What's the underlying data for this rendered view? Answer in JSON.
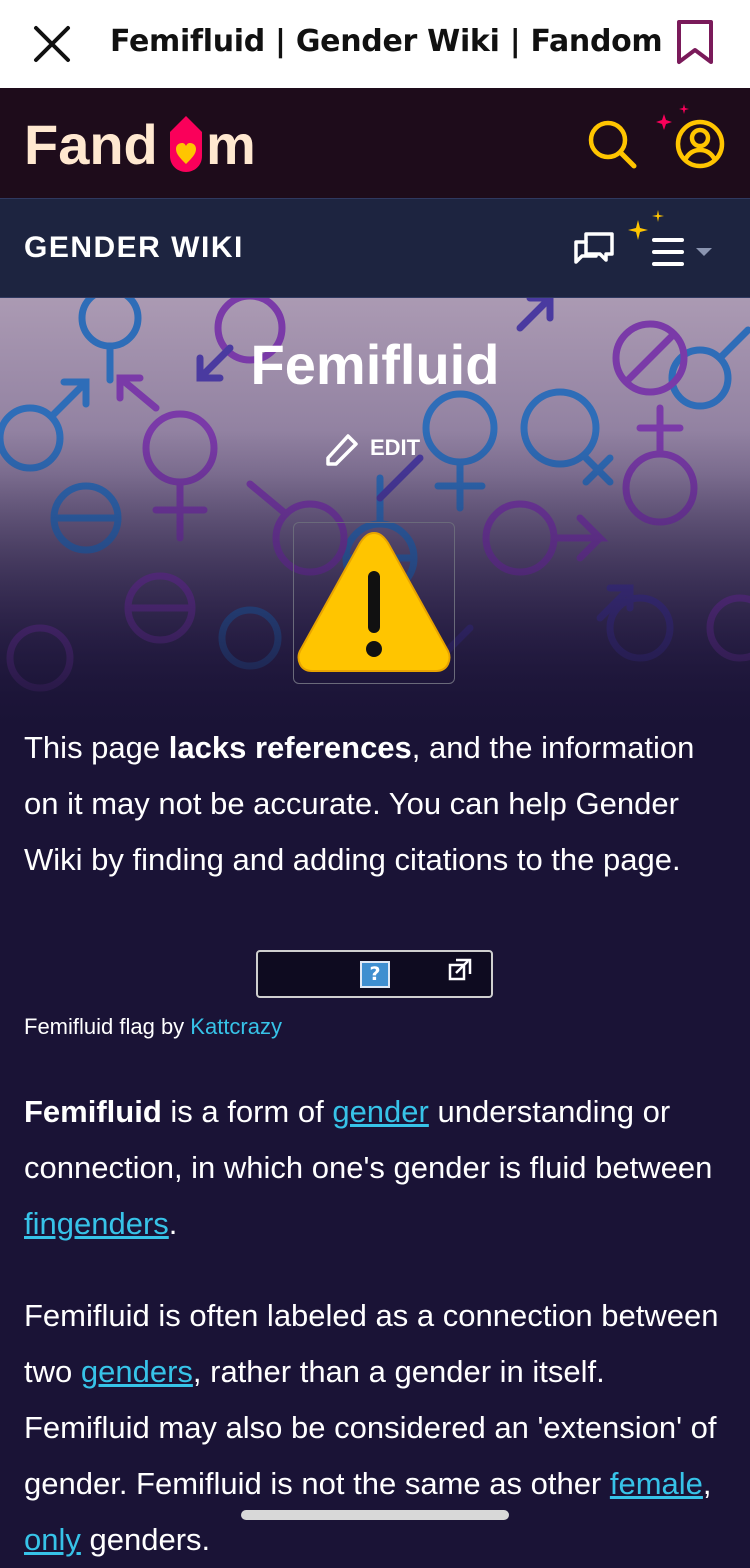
{
  "browser": {
    "title": "Femifluid | Gender Wiki | Fandom",
    "close_icon": "close-icon",
    "bookmark_icon": "bookmark-icon"
  },
  "fandom": {
    "logo_text": "Fandom",
    "search_icon": "search-icon",
    "user_icon": "user-icon"
  },
  "wiki": {
    "name": "GENDER WIKI",
    "discussions_icon": "discussions-icon",
    "menu_icon": "menu-icon"
  },
  "page": {
    "title": "Femifluid",
    "edit_label": "EDIT"
  },
  "notice": {
    "pre": "This page ",
    "bold": "lacks references",
    "post": ", and the information on it may not be accurate. You can help Gender Wiki by finding and adding citations to the page."
  },
  "image": {
    "placeholder": "?",
    "caption_pre": "Femifluid flag by ",
    "caption_link": "Kattcrazy"
  },
  "para1": {
    "bold": "Femifluid",
    "t1": " is a form of ",
    "link1": "gender",
    "t2": " understanding or connection, in which one's gender is fluid between ",
    "link2": "fingenders",
    "t3": "."
  },
  "para2": {
    "t1": "Femifluid is often labeled as a connection between two ",
    "link1": "genders",
    "t2": ", rather than a gender in itself. Femifluid may also be considered an 'extension' of gender. Femifluid is not the same as other ",
    "link2": "female",
    "t3": ", ",
    "link3": "only",
    "t4": " genders."
  },
  "colors": {
    "link": "#37c3e8",
    "header": "#1e0c1b",
    "wiki_bar": "#1d2440",
    "body": "#1a1336",
    "accent_yellow": "#ffc500",
    "accent_pink": "#fa005a"
  }
}
